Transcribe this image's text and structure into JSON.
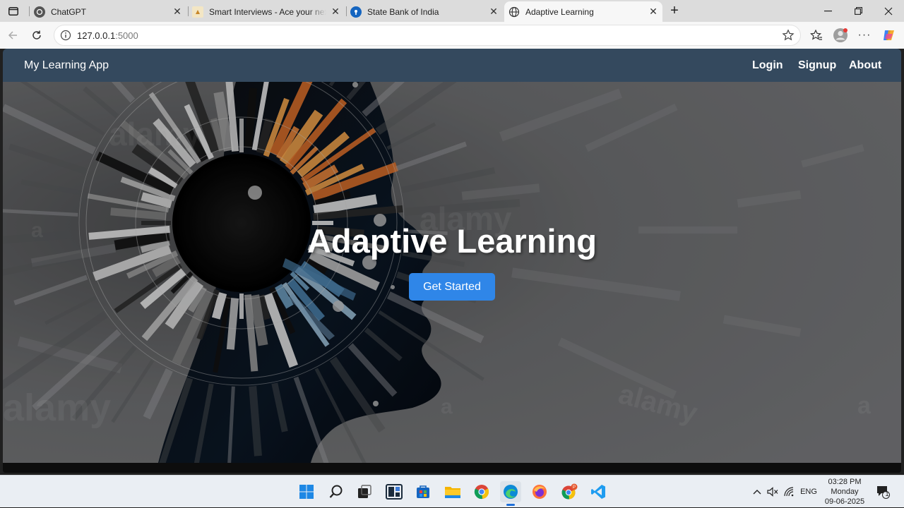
{
  "browser": {
    "tabs": [
      {
        "title": "ChatGPT",
        "icon": "chatgpt-icon",
        "active": false
      },
      {
        "title": "Smart Interviews - Ace your next",
        "icon": "smart-interviews-icon",
        "active": false
      },
      {
        "title": "State Bank of India",
        "icon": "sbi-icon",
        "active": false
      },
      {
        "title": "Adaptive Learning",
        "icon": "globe-icon",
        "active": true
      }
    ],
    "url_host": "127.0.0.1",
    "url_port": ":5000"
  },
  "page": {
    "brand": "My Learning App",
    "nav": {
      "login": "Login",
      "signup": "Signup",
      "about": "About"
    },
    "hero_title": "Adaptive Learning",
    "cta_label": "Get Started",
    "navbar_color": "#34495e",
    "accent_color": "#2f86e8"
  },
  "taskbar": {
    "apps": [
      "windows-start-icon",
      "search-icon",
      "task-view-icon",
      "widgets-icon",
      "store-icon",
      "file-explorer-icon",
      "chrome-icon",
      "edge-icon",
      "firefox-icon",
      "chrome-profile-icon",
      "vscode-icon"
    ],
    "language": "ENG",
    "time": "03:28 PM",
    "day": "Monday",
    "date": "09-06-2025",
    "notification_count": "1"
  }
}
